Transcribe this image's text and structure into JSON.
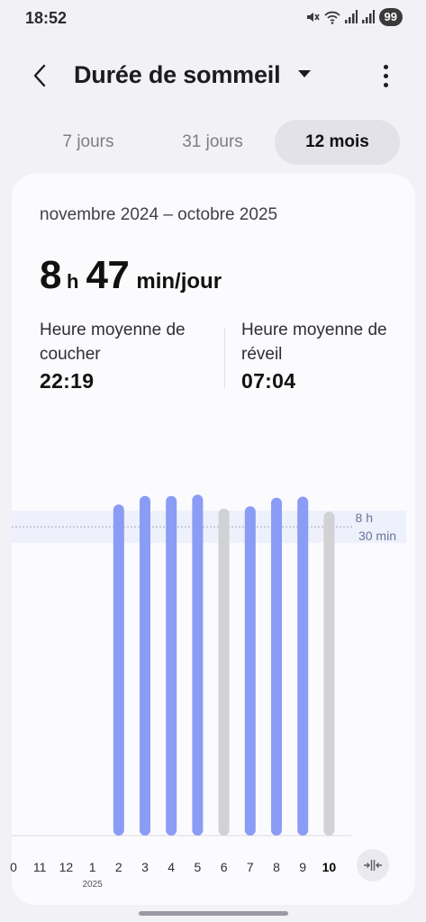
{
  "status_bar": {
    "time": "18:52",
    "battery": "99"
  },
  "header": {
    "title": "Durée de sommeil",
    "back_icon": "chevron-left-icon",
    "menu_icon": "more-vertical-icon"
  },
  "tabs": [
    {
      "label": "7 jours",
      "selected": false
    },
    {
      "label": "31 jours",
      "selected": false
    },
    {
      "label": "12 mois",
      "selected": true
    }
  ],
  "summary": {
    "date_range": "novembre 2024 – octobre 2025",
    "avg_hours": "8",
    "hours_unit": "h",
    "avg_minutes": "47",
    "minutes_unit": "min/jour",
    "bedtime_label": "Heure moyenne de coucher",
    "bedtime_value": "22:19",
    "wake_label": "Heure moyenne de réveil",
    "wake_value": "07:04"
  },
  "chart_data": {
    "type": "bar",
    "categories": [
      "0",
      "11",
      "12",
      "1",
      "2",
      "3",
      "4",
      "5",
      "6",
      "7",
      "8",
      "9",
      "10"
    ],
    "year_marker": {
      "category": "1",
      "label": "2025"
    },
    "current_category": "10",
    "values_minutes": [
      null,
      null,
      null,
      null,
      547,
      561,
      561,
      563,
      540,
      544,
      558,
      560,
      535
    ],
    "bar_colors": [
      "",
      "",
      "",
      "",
      "#8a9cf5",
      "#8a9cf5",
      "#8a9cf5",
      "#8a9cf5",
      "#d2d2d4",
      "#8a9cf5",
      "#8a9cf5",
      "#8a9cf5",
      "#d2d2d4"
    ],
    "goal_minutes": 510,
    "goal_label_line1": "8 h",
    "goal_label_line2": "30 min",
    "ylim": [
      0,
      580
    ],
    "colors": {
      "above_goal": "#8a9cf5",
      "below_goal": "#d2d2d4",
      "goal_band": "#eef1fb"
    }
  }
}
